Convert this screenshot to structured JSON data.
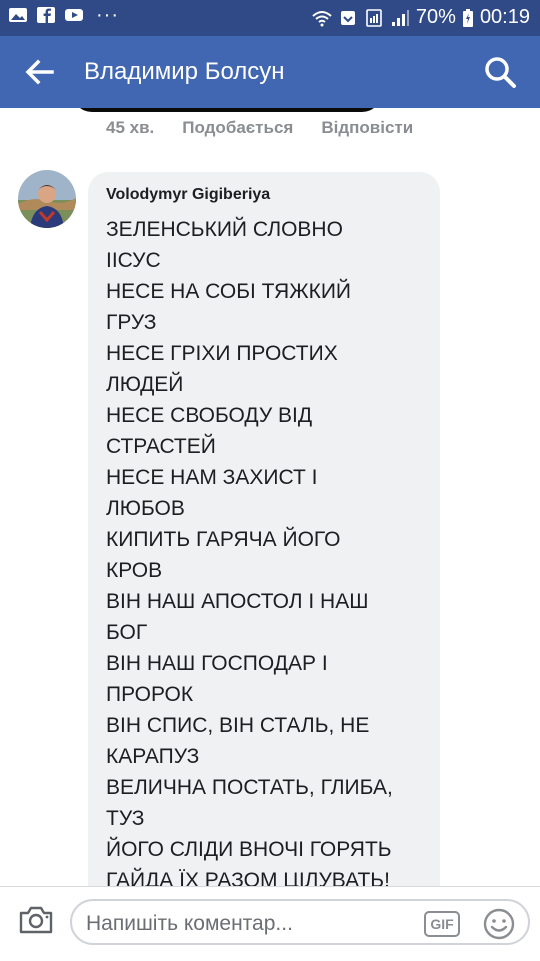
{
  "status_bar": {
    "battery": "70%",
    "time": "00:19",
    "dots": "···",
    "icons": [
      "gallery-icon",
      "facebook-icon",
      "youtube-icon",
      "wifi-icon",
      "notification-icon",
      "sim-icon",
      "signal-icon",
      "battery-icon"
    ]
  },
  "header": {
    "title": "Владимир Болсун",
    "icons": [
      "back-arrow-icon",
      "search-icon"
    ]
  },
  "previous_comment": {
    "time": "45 хв.",
    "like_label": "Подобається",
    "reply_label": "Відповісти"
  },
  "comment": {
    "author": "Volodymyr Gigiberiya",
    "lines": [
      "ЗЕЛЕНСЬКИЙ СЛОВНО",
      "ІІСУС",
      "НЕСЕ НА СОБІ ТЯЖКИЙ",
      "ГРУЗ",
      "НЕСЕ ГРІХИ ПРОСТИХ",
      "ЛЮДЕЙ",
      "НЕСЕ СВОБОДУ ВІД",
      "СТРАСТЕЙ",
      "НЕСЕ НАМ ЗАХИСТ І",
      "ЛЮБОВ",
      "КИПИТЬ ГАРЯЧА ЙОГО",
      "КРОВ",
      "ВІН НАШ АПОСТОЛ І НАШ",
      "БОГ",
      "ВІН НАШ ГОСПОДАР І",
      "ПРОРОК",
      "ВІН СПИС, ВІН СТАЛЬ, НЕ",
      "КАРАПУЗ",
      "ВЕЛИЧНА ПОСТАТЬ, ГЛИБА,",
      "ТУЗ",
      "ЙОГО СЛІДИ ВНОЧІ ГОРЯТЬ",
      "ГАЙДА ЇХ РАЗОМ ЦІЛУВАТЬ!"
    ]
  },
  "composer": {
    "placeholder": "Напишіть коментар...",
    "gif_label": "GIF",
    "icons": [
      "camera-icon",
      "emoji-icon"
    ]
  },
  "colors": {
    "status_bar": "#2f4a86",
    "app_bar": "#4267b2",
    "bubble": "#f0f1f3",
    "meta_text": "#8a8d91"
  }
}
